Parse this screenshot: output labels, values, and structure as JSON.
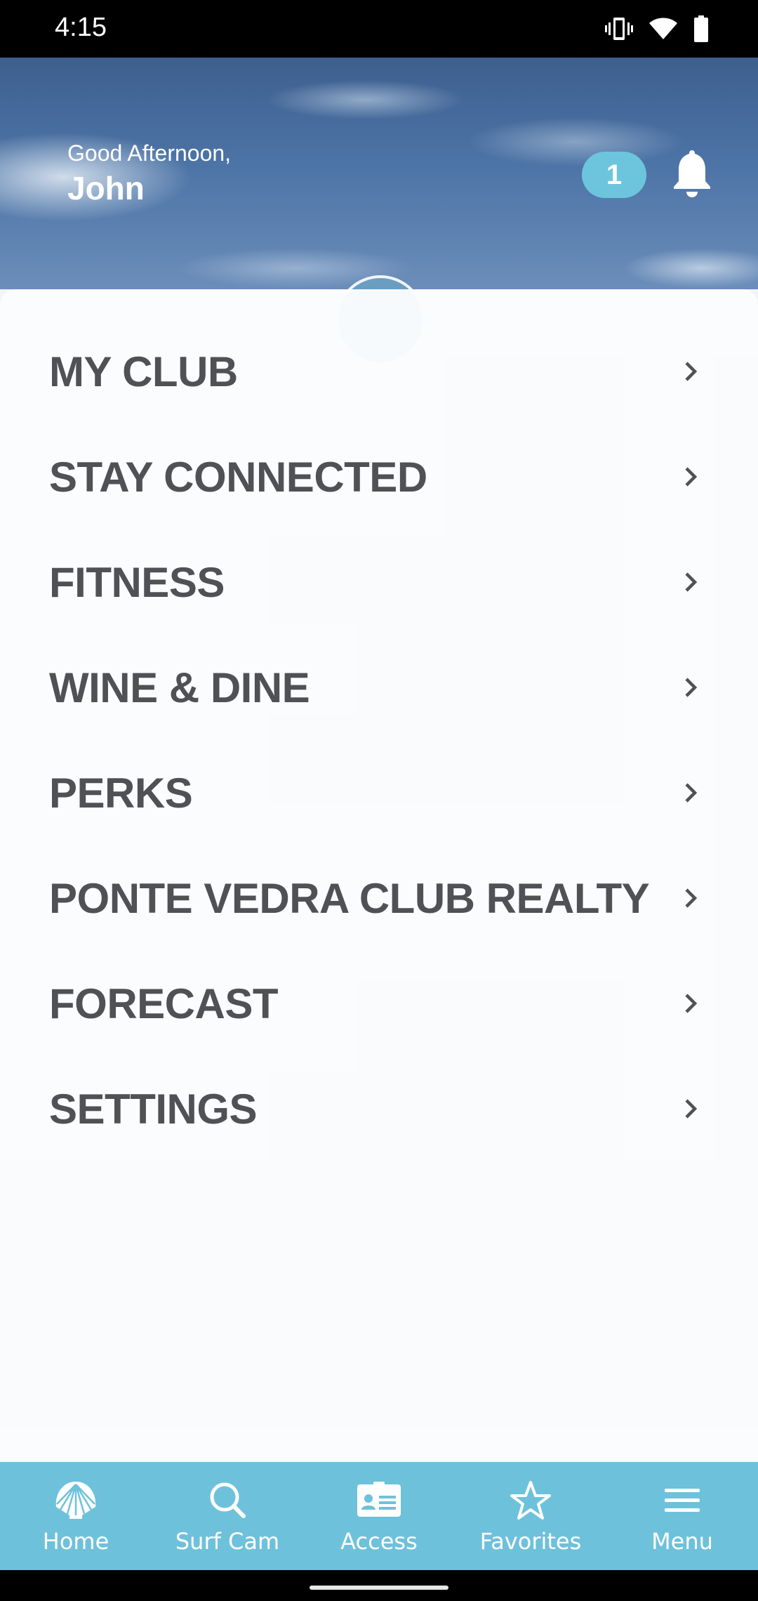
{
  "status_bar": {
    "time": "4:15",
    "icons": [
      "vibrate-icon",
      "wifi-icon",
      "battery-icon"
    ]
  },
  "header": {
    "greeting": "Good Afternoon,",
    "name": "John",
    "notification_count": "1",
    "bell_icon": "bell-icon"
  },
  "menu": {
    "items": [
      {
        "label": "MY CLUB"
      },
      {
        "label": "STAY CONNECTED"
      },
      {
        "label": "FITNESS"
      },
      {
        "label": "WINE & DINE"
      },
      {
        "label": "PERKS"
      },
      {
        "label": "PONTE VEDRA CLUB REALTY"
      },
      {
        "label": "FORECAST"
      },
      {
        "label": "SETTINGS"
      }
    ]
  },
  "bottom_nav": {
    "items": [
      {
        "label": "Home",
        "icon": "shell-icon"
      },
      {
        "label": "Surf Cam",
        "icon": "search-icon"
      },
      {
        "label": "Access",
        "icon": "id-card-icon"
      },
      {
        "label": "Favorites",
        "icon": "star-icon"
      },
      {
        "label": "Menu",
        "icon": "hamburger-icon"
      }
    ]
  },
  "colors": {
    "accent": "#6ec1db",
    "menu_text": "#4f5155",
    "status_bar": "#000000"
  }
}
